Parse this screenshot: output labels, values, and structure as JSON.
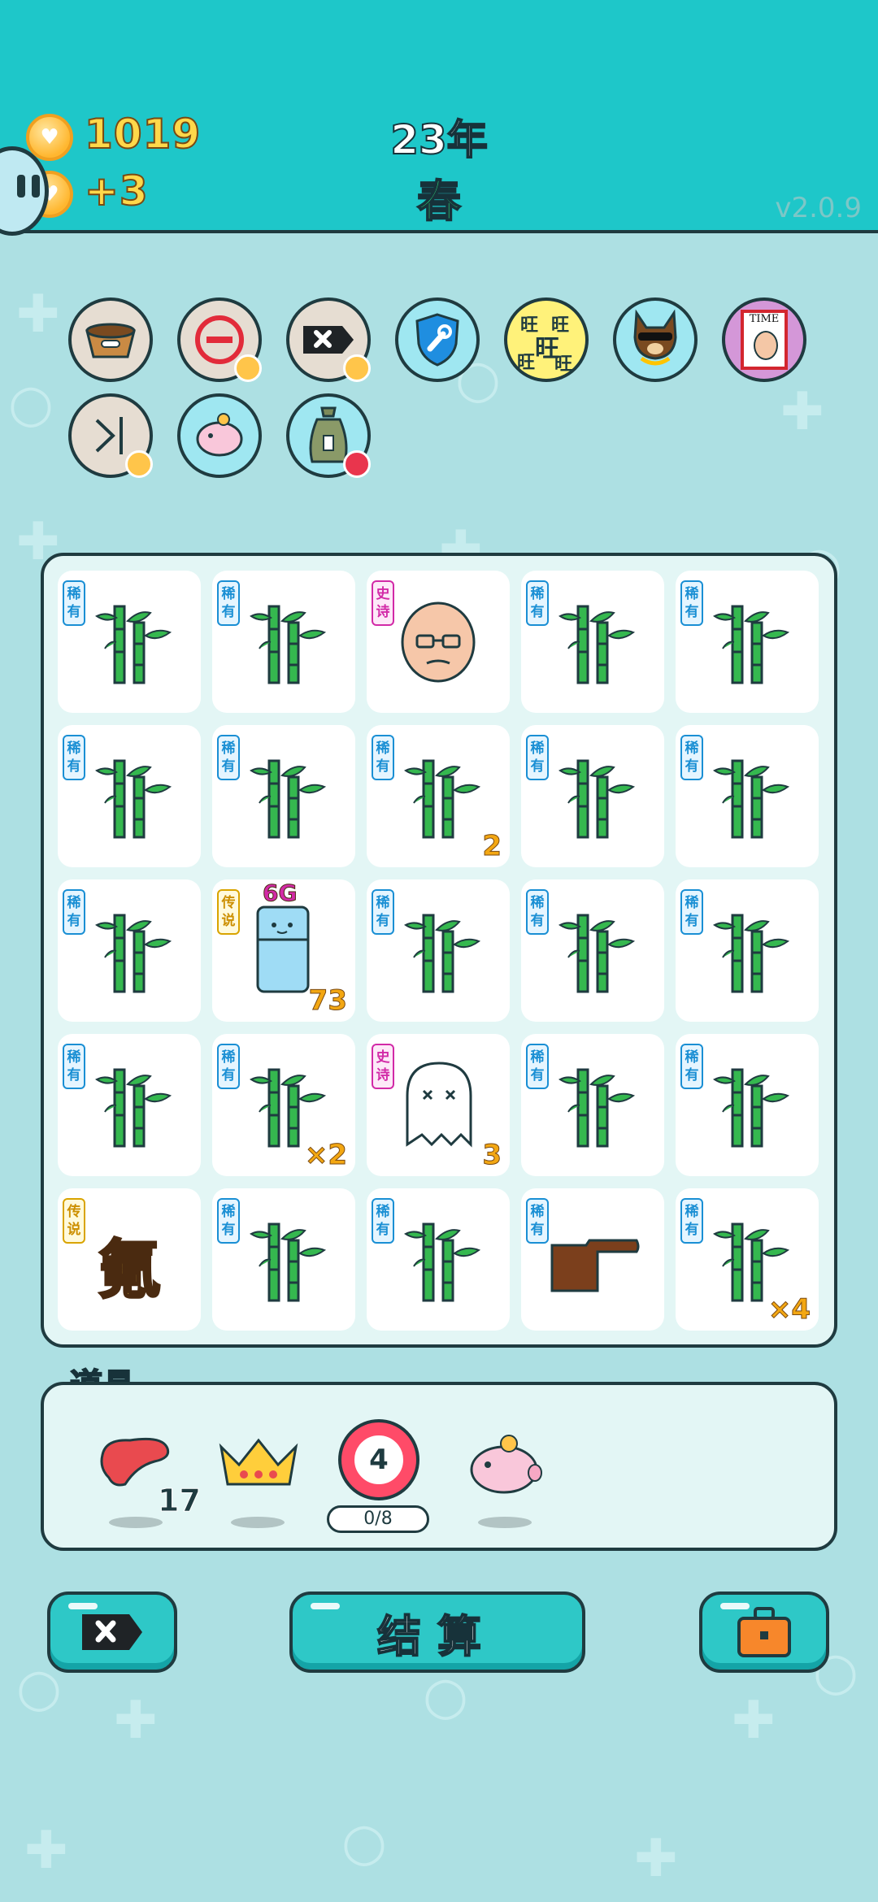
{
  "header": {
    "coins": "1019",
    "income": "+3",
    "year": "23年",
    "season": "春",
    "version": "v2.0.9"
  },
  "perks": [
    {
      "icon": "pet-food-bowl-icon"
    },
    {
      "icon": "minus-circle-icon"
    },
    {
      "icon": "delete-tag-icon"
    },
    {
      "icon": "wrench-shield-icon"
    },
    {
      "icon": "wang-wang-icon",
      "text": "旺"
    },
    {
      "icon": "cool-dog-icon"
    },
    {
      "icon": "time-magazine-icon",
      "text": "TIME"
    },
    {
      "icon": "skip-arrow-icon"
    },
    {
      "icon": "piggy-bank-icon"
    },
    {
      "icon": "money-bag-icon"
    }
  ],
  "board": {
    "cells": [
      {
        "type": "bamboo",
        "tag": "稀有"
      },
      {
        "type": "bamboo",
        "tag": "稀有"
      },
      {
        "type": "old-man",
        "tag": "史诗"
      },
      {
        "type": "bamboo",
        "tag": "稀有"
      },
      {
        "type": "bamboo",
        "tag": "稀有"
      },
      {
        "type": "bamboo",
        "tag": "稀有"
      },
      {
        "type": "bamboo",
        "tag": "稀有"
      },
      {
        "type": "bamboo",
        "tag": "稀有",
        "count": "2"
      },
      {
        "type": "bamboo",
        "tag": "稀有"
      },
      {
        "type": "bamboo",
        "tag": "稀有"
      },
      {
        "type": "bamboo",
        "tag": "稀有"
      },
      {
        "type": "fridge",
        "tag": "传说",
        "count": "73",
        "note": "6G"
      },
      {
        "type": "bamboo",
        "tag": "稀有"
      },
      {
        "type": "bamboo",
        "tag": "稀有"
      },
      {
        "type": "bamboo",
        "tag": "稀有"
      },
      {
        "type": "bamboo",
        "tag": "稀有"
      },
      {
        "type": "bamboo",
        "tag": "稀有",
        "count": "×2"
      },
      {
        "type": "ghost",
        "tag": "史诗",
        "count": "3"
      },
      {
        "type": "bamboo",
        "tag": "稀有"
      },
      {
        "type": "bamboo",
        "tag": "稀有"
      },
      {
        "type": "krypton",
        "tag": "传说",
        "char": "氪"
      },
      {
        "type": "bamboo",
        "tag": "稀有"
      },
      {
        "type": "bamboo",
        "tag": "稀有"
      },
      {
        "type": "pointing-hand",
        "tag": "稀有"
      },
      {
        "type": "bamboo",
        "tag": "稀有",
        "count": "×4"
      }
    ]
  },
  "items": {
    "label": "道具",
    "list": [
      {
        "icon": "liver-icon",
        "count": "17"
      },
      {
        "icon": "crown-icon"
      },
      {
        "icon": "target-badge-icon",
        "value": "4",
        "progress": "0/8"
      },
      {
        "icon": "piggy-bank-icon"
      }
    ]
  },
  "actions": {
    "settle_label": "结算"
  },
  "colors": {
    "background": "#ade0e3",
    "header": "#1ec7c9",
    "rare": "#1a8fd4",
    "epic": "#d22aa7",
    "legend": "#cc8f00",
    "count": "#f3a712"
  }
}
